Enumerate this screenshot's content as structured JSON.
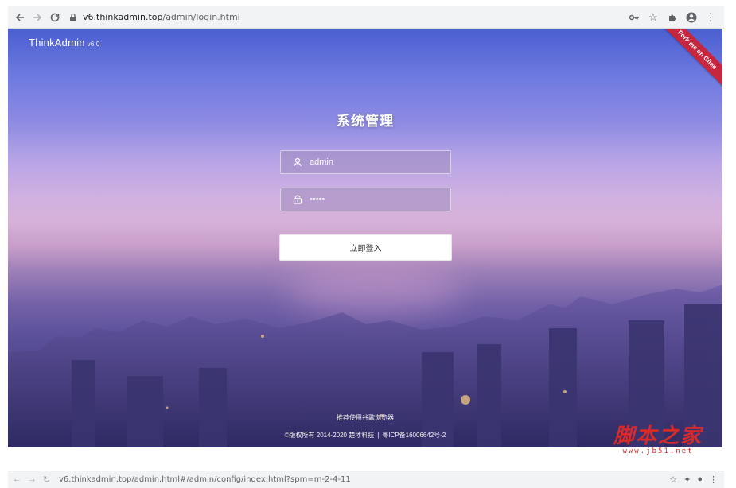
{
  "browser": {
    "url_host": "v6.thinkadmin.top",
    "url_path": "/admin/login.html",
    "icons": [
      "back-icon",
      "forward-icon",
      "reload-icon",
      "lock-icon",
      "key-icon",
      "star-icon",
      "extensions-icon",
      "profile-icon",
      "menu-icon"
    ]
  },
  "brand": {
    "name": "ThinkAdmin",
    "version": "v6.0"
  },
  "ribbon": {
    "label": "Fork me on Gitee",
    "color": "#c7263f"
  },
  "login": {
    "title": "系统管理",
    "username_value": "admin",
    "password_value": "•••••",
    "submit_label": "立即登入"
  },
  "footer": {
    "recommend": "推荐使用谷歌浏览器",
    "copyright": "©版权所有 2014-2020 楚才科技",
    "icp": "粤ICP备16006642号-2"
  },
  "second_tab": {
    "url": "v6.thinkadmin.top/admin.html#/admin/config/index.html?spm=m-2-4-11"
  },
  "watermark": {
    "main": "脚本之家",
    "sub": "www.jb51.net",
    "color": "#d92a2a"
  }
}
